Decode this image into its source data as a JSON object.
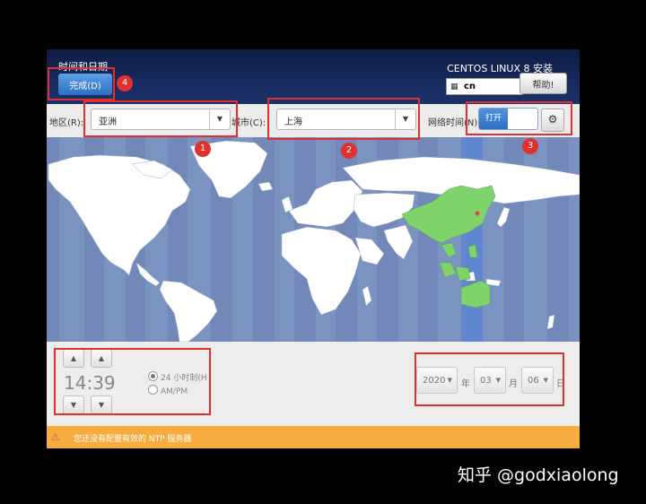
{
  "header": {
    "title": "时间和日期",
    "done_label": "完成(D)",
    "product": "CENTOS LINUX 8 安装",
    "keyboard_layout": "cn",
    "help_label": "帮助!"
  },
  "toolbar": {
    "region_label": "地区(R):",
    "region_value": "亚洲",
    "city_label": "城市(C):",
    "city_value": "上海",
    "ntp_label": "网络时间(N)",
    "ntp_toggle": "打开"
  },
  "time": {
    "value": "14:39",
    "format_24h": "24 小时制(H",
    "format_ampm": "AM/PM"
  },
  "date": {
    "year": "2020",
    "year_unit": "年",
    "month": "03",
    "month_unit": "月",
    "day": "06",
    "day_unit": "日"
  },
  "warning": {
    "text": "您还没有配置有效的 NTP 服务器"
  },
  "annotations": [
    "1",
    "2",
    "3",
    "4"
  ],
  "watermark": "知乎 @godxiaolong",
  "colors": {
    "header": "#172a5e",
    "ocean": "#7b93c0",
    "land": "#ffffff",
    "selected_timezone": "#7ed36b",
    "warning": "#f7ac3f",
    "annotation": "#e0302f"
  },
  "icons": {
    "keyboard": "keyboard-icon",
    "gear": "gear-icon",
    "warning": "warning-icon",
    "city_marker": "location-marker-icon"
  }
}
